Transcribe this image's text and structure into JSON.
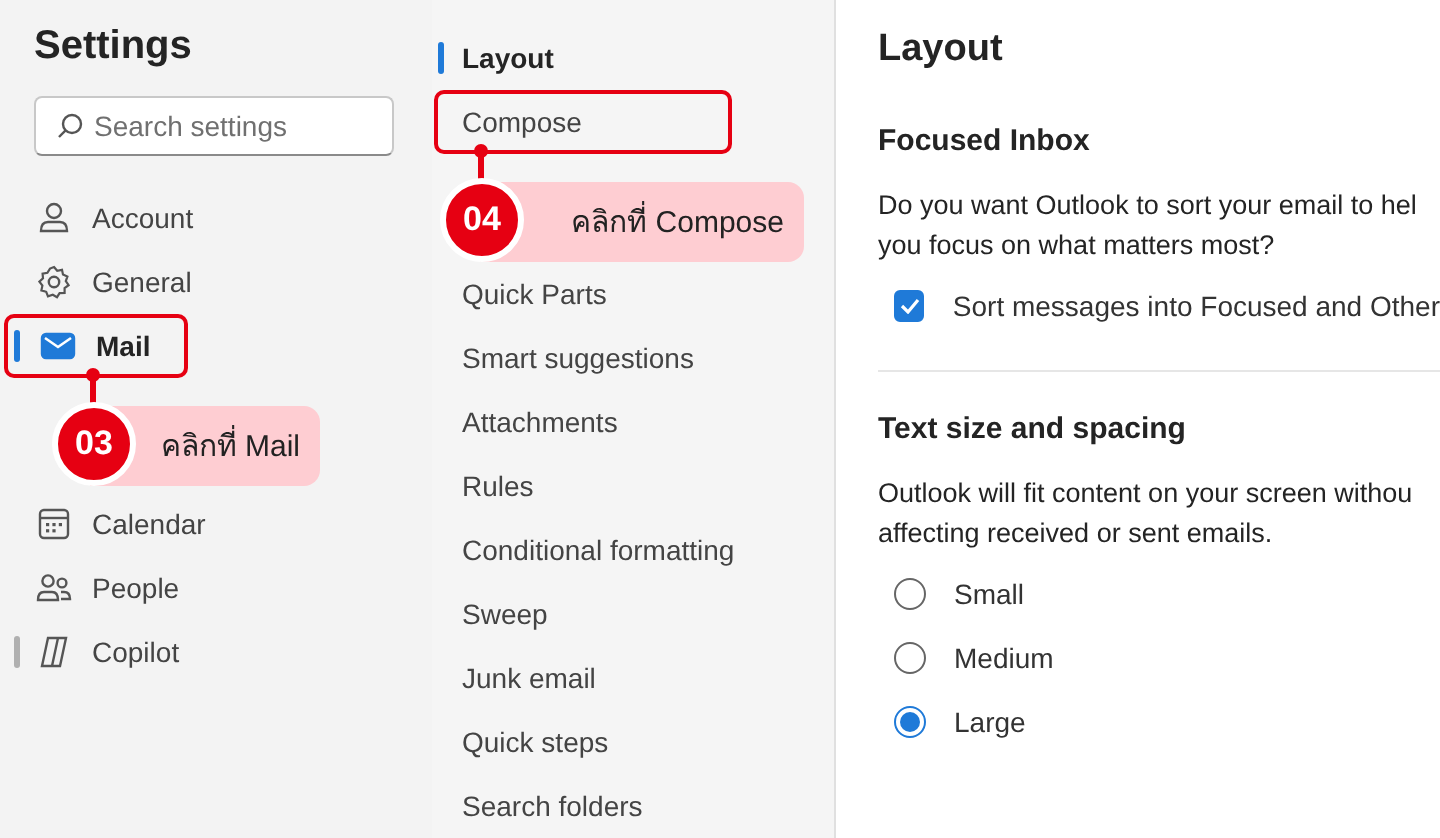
{
  "sidebar": {
    "title": "Settings",
    "search": {
      "placeholder": "Search settings"
    },
    "items": [
      {
        "label": "Account",
        "selected": false,
        "marker": false
      },
      {
        "label": "General",
        "selected": false,
        "marker": false
      },
      {
        "label": "Mail",
        "selected": true,
        "marker": false,
        "callout": {
          "number": "03",
          "text": "คลิกที่ Mail"
        }
      },
      {
        "label": "Calendar",
        "selected": false,
        "marker": false
      },
      {
        "label": "People",
        "selected": false,
        "marker": false
      },
      {
        "label": "Copilot",
        "selected": false,
        "marker": true
      }
    ]
  },
  "submenu": {
    "items": [
      {
        "label": "Layout",
        "selected": true
      },
      {
        "label": "Compose",
        "selected": false,
        "callout": {
          "number": "04",
          "text": "คลิกที่ Compose"
        }
      },
      {
        "label": "Quick Parts",
        "selected": false
      },
      {
        "label": "Smart suggestions",
        "selected": false
      },
      {
        "label": "Attachments",
        "selected": false
      },
      {
        "label": "Rules",
        "selected": false
      },
      {
        "label": "Conditional formatting",
        "selected": false
      },
      {
        "label": "Sweep",
        "selected": false
      },
      {
        "label": "Junk email",
        "selected": false
      },
      {
        "label": "Quick steps",
        "selected": false
      },
      {
        "label": "Search folders",
        "selected": false
      }
    ]
  },
  "content": {
    "title": "Layout",
    "sections": [
      {
        "heading": "Focused Inbox",
        "description": [
          "Do you want Outlook to sort your email to hel",
          "you focus on what matters most?"
        ],
        "options": [
          {
            "kind": "checkbox",
            "label": "Sort messages into Focused and Other",
            "checked": true
          }
        ]
      },
      {
        "heading": "Text size and spacing",
        "description": [
          "Outlook will fit content on your screen withou",
          "affecting received or sent emails."
        ],
        "options": [
          {
            "kind": "radio",
            "label": "Small",
            "selected": false
          },
          {
            "kind": "radio",
            "label": "Medium",
            "selected": false
          },
          {
            "kind": "radio",
            "label": "Large",
            "selected": true
          }
        ]
      }
    ]
  }
}
